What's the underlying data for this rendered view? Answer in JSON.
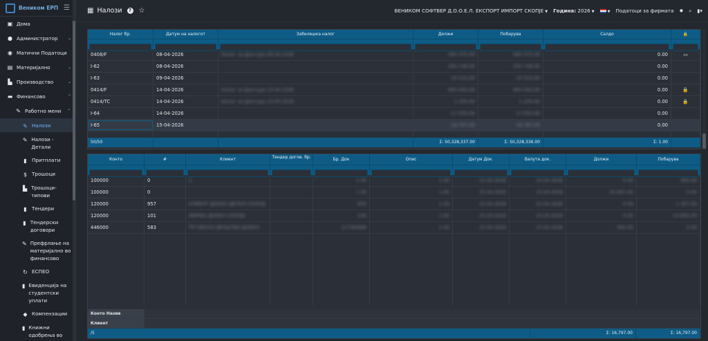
{
  "brand": {
    "name": "Веником ЕРП"
  },
  "sidebar": {
    "items": [
      {
        "label": "Дома",
        "icon": "home-icon",
        "glyph": "▣",
        "chevron": ""
      },
      {
        "label": "Администратор",
        "icon": "user-icon",
        "glyph": "●",
        "chevron": "⌄"
      },
      {
        "label": "Матични Податоци",
        "icon": "database-icon",
        "glyph": "◉",
        "chevron": ""
      },
      {
        "label": "Материјално",
        "icon": "boxes-icon",
        "glyph": "▤",
        "chevron": "⌄"
      },
      {
        "label": "Производство",
        "icon": "factory-icon",
        "glyph": "▙",
        "chevron": "⌄"
      },
      {
        "label": "Финансово",
        "icon": "money-icon",
        "glyph": "▬",
        "chevron": "⌃"
      }
    ],
    "submenu": {
      "label": "Работно мени",
      "chevron": "⌃"
    },
    "subitems": [
      {
        "label": "Налози",
        "icon": "edit-icon",
        "glyph": "✎"
      },
      {
        "label": "Налози - Детали",
        "icon": "edit-icon",
        "glyph": "✎"
      },
      {
        "label": "Притплати",
        "icon": "receipt-icon",
        "glyph": "▮"
      },
      {
        "label": "Трошоци",
        "icon": "dollar-icon",
        "glyph": "$"
      },
      {
        "label": "Трошоци-типови",
        "icon": "bank-icon",
        "glyph": "▙"
      },
      {
        "label": "Тендери",
        "icon": "gavel-icon",
        "glyph": "▮"
      },
      {
        "label": "Тендерски договори",
        "icon": "contract-icon",
        "glyph": "▮"
      },
      {
        "label": "Префрлање на материјално во финансово",
        "icon": "edit-icon",
        "glyph": "✎"
      },
      {
        "label": "ЕСПЕО",
        "icon": "refresh-icon",
        "glyph": "↻"
      },
      {
        "label": "Евиденција на студентски уплати",
        "icon": "list-icon",
        "glyph": "▮"
      },
      {
        "label": "Компензации",
        "icon": "handshake-icon",
        "glyph": "◆"
      },
      {
        "label": "Книжни одобрења во финансово",
        "icon": "book-icon",
        "glyph": "▮"
      }
    ]
  },
  "topbar": {
    "title": "Налози",
    "help": "?",
    "company": "ВЕНИКОМ СОФТВЕР Д.О.О.Е.Л. ЕКСПОРТ ИМПОРТ СКОПЈЕ",
    "year_label": "Година:",
    "year": "2026",
    "lang": "EN",
    "company_data": "Податоци за фирмата"
  },
  "orders": {
    "columns": [
      "Налог бр.",
      "Датум на налогот",
      "Забелешка налог",
      "Должи",
      "Побарува",
      "Салдо",
      "🔒"
    ],
    "rows": [
      {
        "no": "0408/F",
        "date": "08-04-2026",
        "note": "Налог за фактура 08.04.2026",
        "debit": "585.375,00",
        "credit": "585.375,00",
        "saldo": "0.00",
        "lock": "▭"
      },
      {
        "no": "I-62",
        "date": "08-04-2026",
        "note": "",
        "debit": "200.748,00",
        "credit": "200.748,00",
        "saldo": "0.00",
        "lock": ""
      },
      {
        "no": "I-63",
        "date": "09-04-2026",
        "note": "",
        "debit": "10.510,00",
        "credit": "10.510,00",
        "saldo": "0.00",
        "lock": ""
      },
      {
        "no": "0414/F",
        "date": "14-04-2026",
        "note": "Налог за фактура 14.04.2026",
        "debit": "993.000,00",
        "credit": "993.000,00",
        "saldo": "0.00",
        "lock": "🔒"
      },
      {
        "no": "0414/TC",
        "date": "14-04-2026",
        "note": "Налог за фактура 14.04.2026",
        "debit": "1.200,00",
        "credit": "1.200,00",
        "saldo": "0.00",
        "lock": "🔒"
      },
      {
        "no": "I-64",
        "date": "14-04-2026",
        "note": "",
        "debit": "17.503,00",
        "credit": "17.503,00",
        "saldo": "0.00",
        "lock": ""
      },
      {
        "no": "I-65",
        "date": "15-04-2026",
        "note": "",
        "debit": "16.797,00",
        "credit": "16.797,00",
        "saldo": "0.00",
        "lock": ""
      }
    ],
    "footer": {
      "count": "50/50",
      "sum_debit": "Σ: 50,328,337.00",
      "sum_credit": "Σ: 50,328,336.00",
      "sum_saldo": "Σ: 1.00"
    }
  },
  "details": {
    "columns": [
      "Конто",
      "#",
      "Клиент",
      "Тендер догов. бр.",
      "Бр. Док",
      "Опис",
      "Датум Док.",
      "Валута док.",
      "Должи",
      "Побарува"
    ],
    "rows": [
      {
        "konto": "100000",
        "num": "0",
        "client": "1",
        "tender": "",
        "doc": "1.00",
        "opis": "1.00",
        "date": "15.04.2026",
        "valuta": "15.04.2026",
        "debit": "0.00",
        "credit": "590,00"
      },
      {
        "konto": "100000",
        "num": "0",
        "client": "",
        "tender": "",
        "doc": "1.00",
        "opis": "1.00",
        "date": "15.04.2026",
        "valuta": "15.04.2026",
        "debit": "16.697,00",
        "credit": "0.00"
      },
      {
        "konto": "120000",
        "num": "957",
        "client": "КЛИЕНТ ДООЕЛ ДЕЛАЛ СКОПЈЕ",
        "tender": "",
        "doc": "850",
        "opis": "1.00",
        "date": "15.04.2026",
        "valuta": "15.04.2026",
        "debit": "0.00",
        "credit": "1.357,00"
      },
      {
        "konto": "120000",
        "num": "101",
        "client": "ФИРМА ДООЕЛ СКОПЈЕ",
        "tender": "",
        "doc": "100",
        "opis": "1.00",
        "date": "15.04.2026",
        "valuta": "15.04.2026",
        "debit": "0.00",
        "credit": "14.850,00"
      },
      {
        "konto": "446000",
        "num": "583",
        "client": "ТРГОВСКО ДРУШТВО ДООЕЛ",
        "tender": "",
        "doc": "21758/866",
        "opis": "1.00",
        "date": "15.04.2026",
        "valuta": "15.04.2026",
        "debit": "590,00",
        "credit": "0.00"
      }
    ],
    "konto_label": "Конто Назив",
    "client_label": "Клиент",
    "footer": {
      "count": "/5",
      "sum_debit": "Σ: 16,797.00",
      "sum_credit": "Σ: 16,797.00"
    }
  },
  "colors": {
    "accent": "#0e5c86",
    "bg": "#23272e",
    "panel": "#2b3038",
    "link_active": "#6fb5ff"
  }
}
